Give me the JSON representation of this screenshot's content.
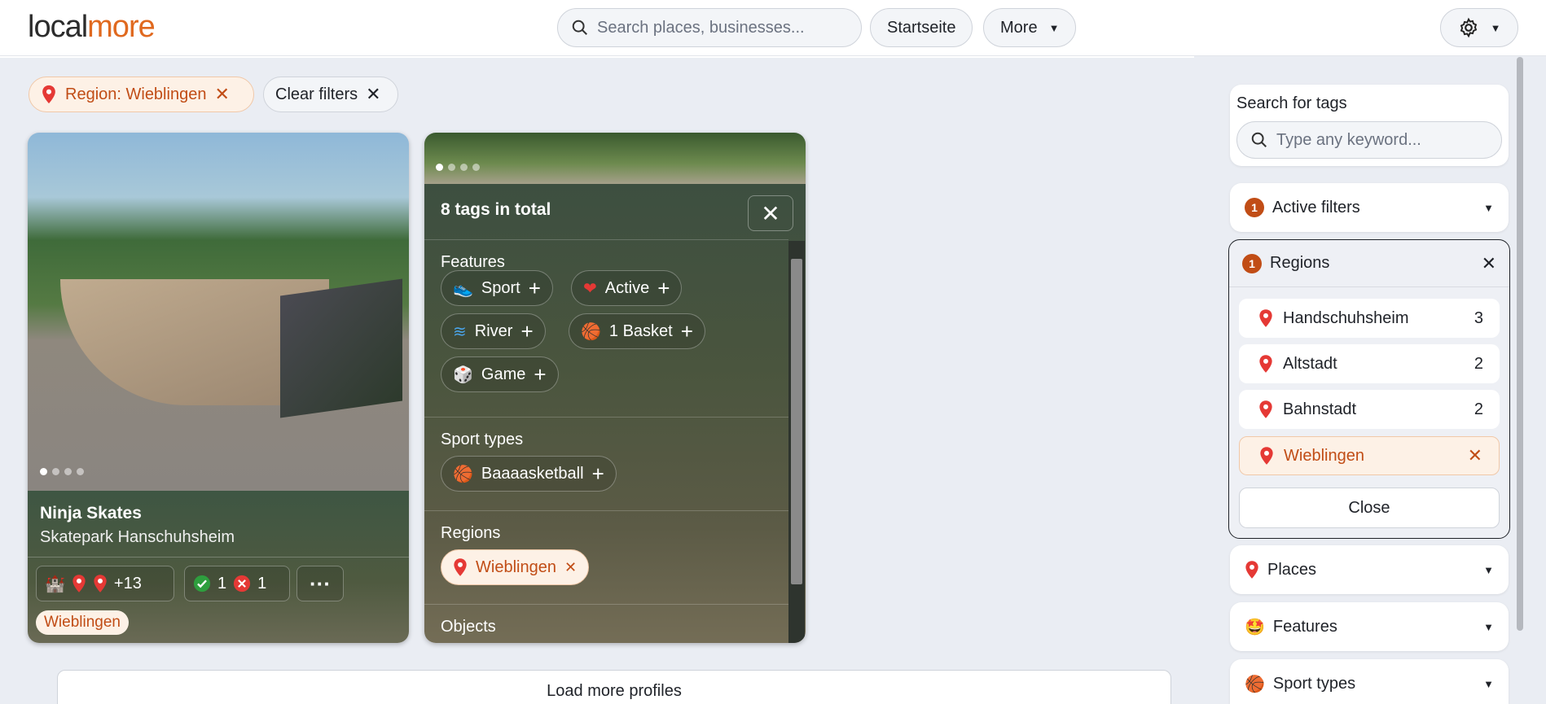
{
  "brand": {
    "logo_part1": "local",
    "logo_part2": "more"
  },
  "header": {
    "search_placeholder": "Search places, businesses...",
    "home_label": "Startseite",
    "more_label": "More"
  },
  "filters": {
    "region_chip": "Region: Wieblingen",
    "clear_label": "Clear filters"
  },
  "card1": {
    "title": "Ninja Skates",
    "subtitle": "Skatepark Hanschuhsheim",
    "more_count": "+13",
    "yes_count": "1",
    "no_count": "1",
    "region_tag": "Wieblingen"
  },
  "tags_panel": {
    "title": "8 tags in total",
    "features_heading": "Features",
    "features": [
      "Sport",
      "Active",
      "River",
      "1 Basket",
      "Game"
    ],
    "sport_types_heading": "Sport types",
    "sport_types": [
      "Baaaasketball"
    ],
    "regions_heading": "Regions",
    "regions": [
      "Wieblingen"
    ],
    "objects_heading": "Objects"
  },
  "load_more": "Load more profiles",
  "sidebar": {
    "search_heading": "Search for tags",
    "search_placeholder": "Type any keyword...",
    "active_filters": {
      "badge": "1",
      "label": "Active filters"
    },
    "regions": {
      "badge": "1",
      "label": "Regions",
      "items": [
        {
          "name": "Handschuhsheim",
          "count": "3"
        },
        {
          "name": "Altstadt",
          "count": "2"
        },
        {
          "name": "Bahnstadt",
          "count": "2"
        },
        {
          "name": "Wieblingen",
          "count": ""
        }
      ],
      "close_label": "Close"
    },
    "places_label": "Places",
    "features_label": "Features",
    "sport_types_label": "Sport types"
  },
  "colors": {
    "accent": "#c14d16",
    "brand_orange": "#e0691f",
    "pin_red": "#e53935"
  }
}
